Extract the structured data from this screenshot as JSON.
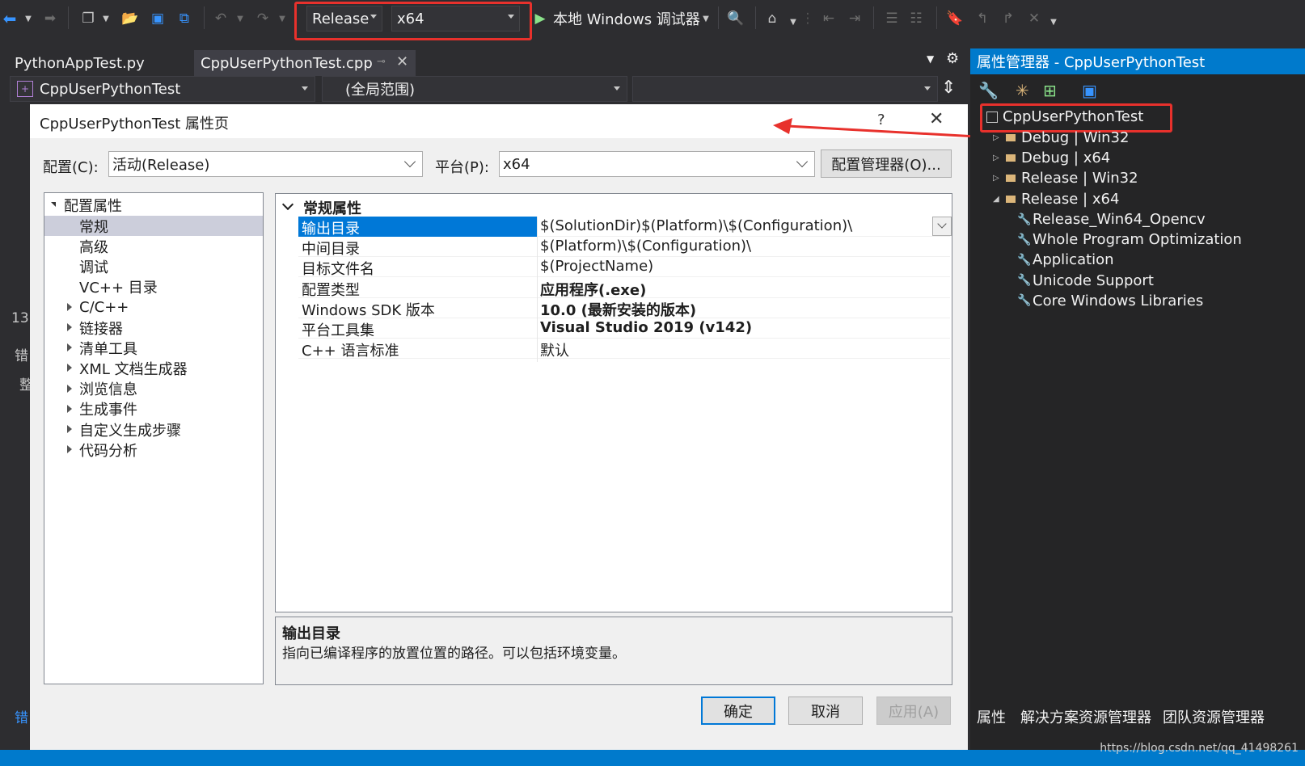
{
  "toolbar": {
    "config": "Release",
    "platform": "x64",
    "run_label": "本地 Windows 调试器"
  },
  "editor": {
    "tabs": [
      "PythonAppTest.py",
      "CppUserPythonTest.cpp"
    ],
    "nav": {
      "project": "CppUserPythonTest",
      "scope": "(全局范围)",
      "member": ""
    },
    "side_fragments": [
      "13",
      "错",
      "整",
      "错"
    ]
  },
  "dialog": {
    "title": "CppUserPythonTest 属性页",
    "help": "?",
    "config_label": "配置(C):",
    "config_value": "活动(Release)",
    "platform_label": "平台(P):",
    "platform_value": "x64",
    "config_manager": "配置管理器(O)...",
    "tree": {
      "root": "配置属性",
      "items": [
        {
          "label": "常规",
          "expandable": false,
          "selected": true
        },
        {
          "label": "高级",
          "expandable": false,
          "selected": false
        },
        {
          "label": "调试",
          "expandable": false,
          "selected": false
        },
        {
          "label": "VC++ 目录",
          "expandable": false,
          "selected": false
        },
        {
          "label": "C/C++",
          "expandable": true,
          "selected": false
        },
        {
          "label": "链接器",
          "expandable": true,
          "selected": false
        },
        {
          "label": "清单工具",
          "expandable": true,
          "selected": false
        },
        {
          "label": "XML 文档生成器",
          "expandable": true,
          "selected": false
        },
        {
          "label": "浏览信息",
          "expandable": true,
          "selected": false
        },
        {
          "label": "生成事件",
          "expandable": true,
          "selected": false
        },
        {
          "label": "自定义生成步骤",
          "expandable": true,
          "selected": false
        },
        {
          "label": "代码分析",
          "expandable": true,
          "selected": false
        }
      ]
    },
    "grid": {
      "section": "常规属性",
      "rows": [
        {
          "name": "输出目录",
          "value": "$(SolutionDir)$(Platform)\\$(Configuration)\\",
          "bold": false,
          "selected": true
        },
        {
          "name": "中间目录",
          "value": "$(Platform)\\$(Configuration)\\",
          "bold": false,
          "selected": false
        },
        {
          "name": "目标文件名",
          "value": "$(ProjectName)",
          "bold": false,
          "selected": false
        },
        {
          "name": "配置类型",
          "value": "应用程序(.exe)",
          "bold": true,
          "selected": false
        },
        {
          "name": "Windows SDK 版本",
          "value": "10.0 (最新安装的版本)",
          "bold": true,
          "selected": false
        },
        {
          "name": "平台工具集",
          "value": "Visual Studio 2019 (v142)",
          "bold": true,
          "selected": false
        },
        {
          "name": "C++ 语言标准",
          "value": "默认",
          "bold": false,
          "selected": false
        }
      ]
    },
    "description": {
      "title": "输出目录",
      "text": "指向已编译程序的放置位置的路径。可以包括环境变量。"
    },
    "buttons": {
      "ok": "确定",
      "cancel": "取消",
      "apply": "应用(A)"
    }
  },
  "property_manager": {
    "title": "属性管理器 - CppUserPythonTest",
    "project": "CppUserPythonTest",
    "configs": [
      {
        "label": "Debug | Win32",
        "expanded": false
      },
      {
        "label": "Debug | x64",
        "expanded": false
      },
      {
        "label": "Release | Win32",
        "expanded": false
      },
      {
        "label": "Release | x64",
        "expanded": true
      }
    ],
    "sheets": [
      "Release_Win64_Opencv",
      "Whole Program Optimization",
      "Application",
      "Unicode Support",
      "Core Windows Libraries"
    ],
    "bottom_tabs": [
      "属性",
      "解决方案资源管理器",
      "团队资源管理器"
    ]
  },
  "watermark": "https://blog.csdn.net/qq_41498261",
  "colors": {
    "accent": "#007acc",
    "highlight": "#e8312c",
    "selection": "#0078d7"
  }
}
